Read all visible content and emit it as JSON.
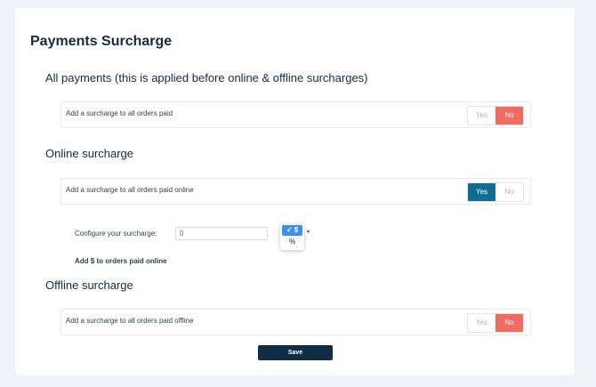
{
  "page_title": "Payments Surcharge",
  "sections": {
    "all": {
      "title": "All payments (this is applied before online & offline surcharges)",
      "row_label": "Add a surcharge to all orders paid",
      "yes": "Yes",
      "no": "No",
      "selected": "No"
    },
    "online": {
      "title": "Online surcharge",
      "row_label": "Add a surcharge to all orders paid online",
      "yes": "Yes",
      "no": "No",
      "selected": "Yes",
      "config_label": "Configure your surcharge:",
      "config_value": "0",
      "unit_options": [
        "✓ $",
        "%"
      ],
      "unit_selected": "$",
      "note": "Add $ to orders paid online"
    },
    "offline": {
      "title": "Offline surcharge",
      "row_label": "Add a surcharge to all orders paid offline",
      "yes": "Yes",
      "no": "No",
      "selected": "No"
    }
  },
  "save_label": "Save",
  "colors": {
    "yes_active": "#0d6e8f",
    "no_active": "#f26b63",
    "primary": "#0f2d45",
    "dropdown_selected": "#3d8ef0"
  },
  "icons": {
    "dropdown_caret": "caret-down-icon",
    "checkmark": "checkmark-icon"
  }
}
